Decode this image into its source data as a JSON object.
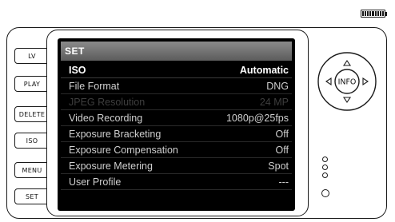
{
  "camera_buttons": [
    "LV",
    "PLAY",
    "DELETE",
    "ISO",
    "MENU",
    "SET"
  ],
  "dial": {
    "center_label": "INFO",
    "arrows": [
      "up-arrow",
      "down-arrow",
      "left-arrow",
      "right-arrow"
    ]
  },
  "battery": {
    "icon": "battery-icon",
    "level": 1.0
  },
  "screen": {
    "title": "SET",
    "items": [
      {
        "label": "ISO",
        "value": "Automatic",
        "state": "selected"
      },
      {
        "label": "File Format",
        "value": "DNG",
        "state": "normal"
      },
      {
        "label": "JPEG Resolution",
        "value": "24 MP",
        "state": "disabled"
      },
      {
        "label": "Video Recording",
        "value": "1080p@25fps",
        "state": "normal"
      },
      {
        "label": "Exposure Bracketing",
        "value": "Off",
        "state": "normal"
      },
      {
        "label": "Exposure Compensation",
        "value": "Off",
        "state": "normal"
      },
      {
        "label": "Exposure Metering",
        "value": "Spot",
        "state": "normal"
      },
      {
        "label": "User Profile",
        "value": "---",
        "state": "normal"
      }
    ]
  },
  "colors": {
    "outline": "#1a1a1a",
    "screen_bg": "#000000",
    "header_bg": "#707070",
    "text_selected": "#ffffff",
    "text_normal": "#cfcfcf",
    "text_disabled": "#3e3e3e"
  }
}
